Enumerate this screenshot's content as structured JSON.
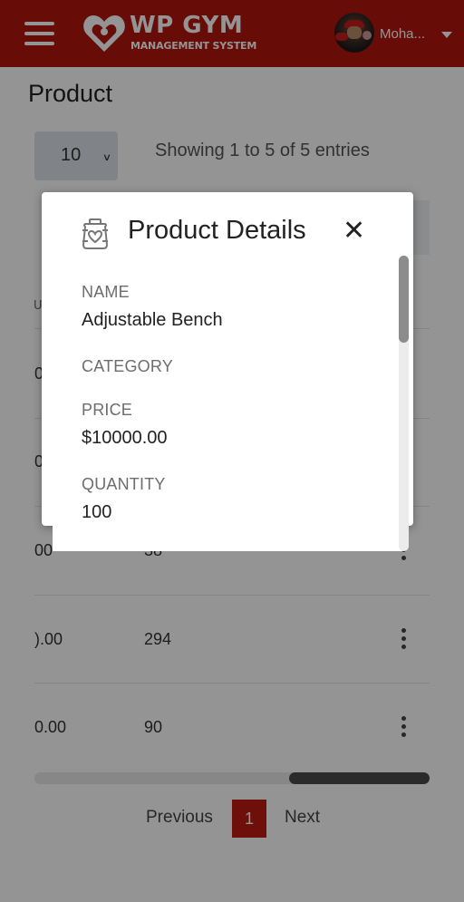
{
  "header": {
    "brand_title": "WP GYM",
    "brand_subtitle": "MANAGEMENT SYSTEM",
    "username": "Moha..."
  },
  "page": {
    "title": "Product",
    "length_value": "10",
    "info": "Showing 1 to 5 of 5 entries"
  },
  "table": {
    "partial_header": "U",
    "rows": [
      {
        "price": "0",
        "qty": ""
      },
      {
        "price": "0",
        "qty": ""
      },
      {
        "price": "00",
        "qty": "38"
      },
      {
        "price": ").00",
        "qty": "294"
      },
      {
        "price": "0.00",
        "qty": "90"
      }
    ]
  },
  "pagination": {
    "previous": "Previous",
    "current": "1",
    "next": "Next"
  },
  "modal": {
    "title": "Product Details",
    "close_glyph": "✕",
    "fields": [
      {
        "label": "NAME",
        "value": "Adjustable Bench"
      },
      {
        "label": "CATEGORY",
        "value": ""
      },
      {
        "label": "PRICE",
        "value": "$10000.00"
      },
      {
        "label": "QUANTITY",
        "value": "100"
      }
    ]
  },
  "colors": {
    "brand": "#b3150f",
    "pagination_active": "#c01a12",
    "overlay": "rgba(0,0,0,0.42)"
  }
}
